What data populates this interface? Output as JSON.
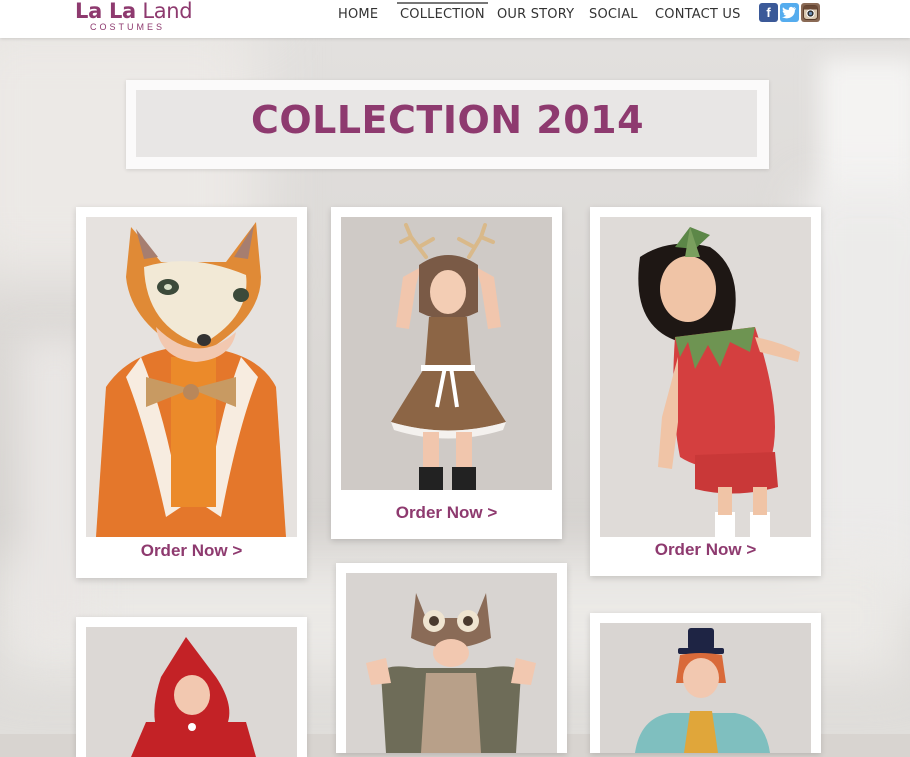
{
  "brand": {
    "name_part1": "La La",
    "name_part2": "Land",
    "subtitle": "COSTUMES"
  },
  "nav": {
    "items": [
      {
        "label": "HOME"
      },
      {
        "label": "COLLECTION"
      },
      {
        "label": "OUR STORY"
      },
      {
        "label": "SOCIAL"
      },
      {
        "label": "CONTACT US"
      }
    ],
    "active": "COLLECTION"
  },
  "social": [
    {
      "name": "facebook-icon",
      "glyph": "f"
    },
    {
      "name": "twitter-icon",
      "glyph": "t"
    },
    {
      "name": "instagram-icon",
      "glyph": ""
    }
  ],
  "page": {
    "title": "COLLECTION 2014"
  },
  "products": [
    {
      "costume": "fox",
      "order_label": "Order Now >"
    },
    {
      "costume": "deer",
      "order_label": "Order Now >"
    },
    {
      "costume": "strawberry",
      "order_label": "Order Now >"
    },
    {
      "costume": "red riding hood",
      "order_label": ""
    },
    {
      "costume": "owl",
      "order_label": ""
    },
    {
      "costume": "mad hatter",
      "order_label": ""
    }
  ],
  "colors": {
    "brand": "#8e3a6f",
    "background": "#d8d4d0",
    "card": "#ffffff"
  }
}
